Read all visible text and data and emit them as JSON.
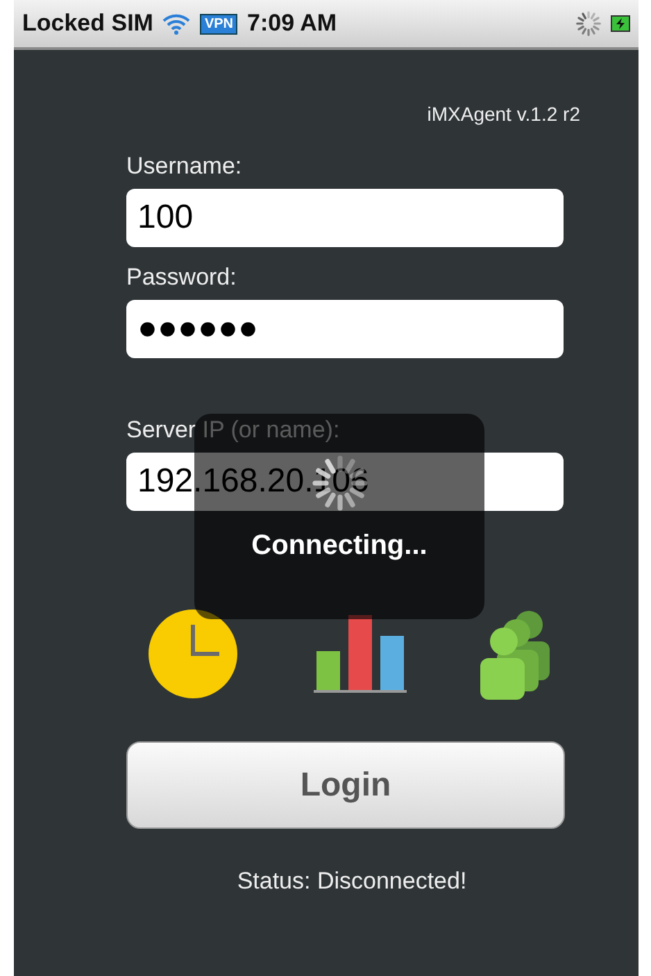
{
  "status_bar": {
    "carrier": "Locked SIM",
    "vpn": "VPN",
    "time": "7:09 AM"
  },
  "version": "iMXAgent v.1.2 r2",
  "fields": [
    {
      "label": "Username:",
      "value": "100"
    },
    {
      "label": "Password:",
      "value": "●●●●●●"
    },
    {
      "label": "Server IP (or name):",
      "value": "192.168.20.106"
    }
  ],
  "login_button": "Login",
  "status": "Status: Disconnected!",
  "overlay": {
    "message": "Connecting..."
  }
}
